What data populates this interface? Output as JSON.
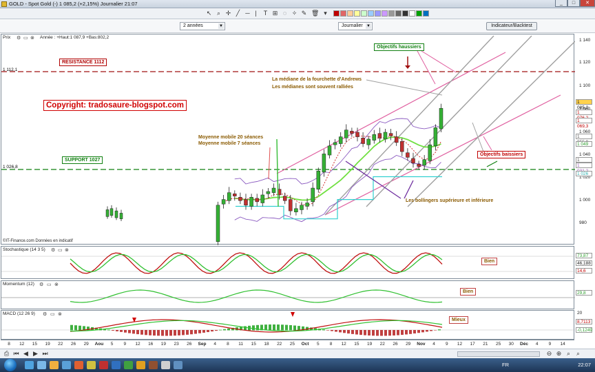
{
  "window": {
    "title": "GOLD - Spot Gold (-)    1 085,2 (+2,15%)    Journalier  21:07",
    "minimize": "_",
    "maximize": "□",
    "close": "✕"
  },
  "toolbar": {
    "icons": [
      "cursor-icon",
      "zoom-icon",
      "crosshair-icon",
      "line-icon",
      "hline-icon",
      "text-icon",
      "fib-icon",
      "magic-icon",
      "pencil-icon",
      "trash-icon"
    ],
    "palette": [
      "#c00000",
      "#e06666",
      "#ffcc99",
      "#ffff99",
      "#ccffcc",
      "#99ccff",
      "#9999ff",
      "#cc99ff",
      "#999999",
      "#666666",
      "#333333",
      "#ffffff",
      "#00a000",
      "#0070c0"
    ]
  },
  "controls": {
    "period": "2 années",
    "interval": "Journalier",
    "indicator_button": "Indicateur/Backtest"
  },
  "price_panel": {
    "label": "Prix",
    "info": "Année : +Haut:1 087,9 +Bas:802,2",
    "resistance_label": "RESISTANCE 1112",
    "resistance_value": "1 112,1",
    "support_label": "SUPPORT 1027",
    "support_value": "1 026,8",
    "copyright": "Copyright: tradosaure-blogspot.com",
    "objectifs_haussiers": "Objectifs haussiers",
    "objectifs_baissiers": "Objectifs baissiers",
    "andrews_line1": "La médiane de la fourchette d'Andrews",
    "andrews_line2": "Les médianes sont souvent ralliées",
    "ma_line1": "Moyenne mobile 20 séances",
    "ma_line2": "Moyenne mobile 7 séances",
    "bollinger": "Les bollingers supérieure et inférieure",
    "source": "©IT-Finance.com  Données en indicatif",
    "scale": [
      "1 140",
      "1 120",
      "1 100",
      "1 080",
      "1 060",
      "1 040",
      "1 020",
      "1 000",
      "980"
    ],
    "price_boxes": [
      {
        "text": "1 085,2",
        "color": "#f4b000"
      },
      {
        "text": "1 076,2",
        "color": "#c00000"
      },
      {
        "text": "1 069,3",
        "color": "#c00000"
      },
      {
        "text": "1 055,9",
        "color": "#555555"
      },
      {
        "text": "1 049",
        "color": "#30a030"
      },
      {
        "text": "1 035,6",
        "color": "#555555"
      },
      {
        "text": "1 031,2",
        "color": "#9b59b6"
      },
      {
        "text": "1 026",
        "color": "#30b0b0"
      }
    ]
  },
  "stochastic_panel": {
    "label": "Stochastique (14 3 5)",
    "status": "Bien",
    "boxes": [
      "73,87",
      "46,188",
      "14,6"
    ]
  },
  "momentum_panel": {
    "label": "Momentum (12)",
    "status": "Bien",
    "boxes": [
      "29,8"
    ]
  },
  "macd_panel": {
    "label": "MACD (12 26 9)",
    "status": "Mieux",
    "scale_top": "20",
    "boxes": [
      "8,7113",
      "-0,1249"
    ]
  },
  "xaxis": {
    "labels": [
      "8",
      "12",
      "15",
      "19",
      "22",
      "26",
      "29",
      "Aou",
      "5",
      "9",
      "12",
      "16",
      "19",
      "23",
      "26",
      "Sep",
      "4",
      "8",
      "11",
      "15",
      "18",
      "22",
      "25",
      "Oct",
      "5",
      "8",
      "12",
      "15",
      "19",
      "22",
      "26",
      "29",
      "Nov",
      "4",
      "9",
      "12",
      "17",
      "21",
      "25",
      "30",
      "Déc",
      "4",
      "9",
      "14"
    ]
  },
  "taskbar": {
    "lang": "FR",
    "clock": "22:07"
  },
  "chart_data": {
    "type": "candlestick",
    "title": "GOLD - Spot Gold (-)",
    "ylim": [
      960,
      1145
    ],
    "closes": [
      1000,
      1005,
      1011,
      1008,
      1004,
      1000,
      1007,
      1003,
      1009,
      1012,
      1015,
      1009,
      1004,
      995,
      997,
      1000,
      1002,
      1015,
      1030,
      1045,
      1052,
      1055,
      1060,
      1066,
      1063,
      1060,
      1054,
      1058,
      1062,
      1059,
      1064,
      1061,
      1055,
      1047,
      1042,
      1037,
      1034,
      1040,
      1053,
      1068,
      1085
    ]
  }
}
